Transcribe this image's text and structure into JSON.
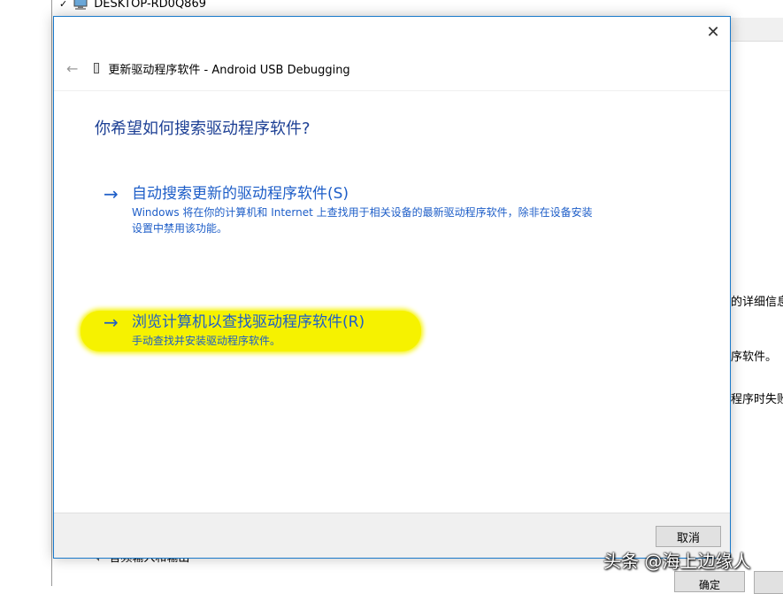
{
  "background": {
    "tree_top_label": "DESKTOP-RD0Q869",
    "tree_bottom_label": "音频输入和输出",
    "right_texts": [
      "的详细信息",
      "序软件。",
      "程序时失败"
    ],
    "ok_button": "确定"
  },
  "dialog": {
    "title": "更新驱动程序软件 - Android USB Debugging",
    "heading": "你希望如何搜索驱动程序软件?",
    "options": [
      {
        "title": "自动搜索更新的驱动程序软件(S)",
        "description": "Windows 将在你的计算机和 Internet 上查找用于相关设备的最新驱动程序软件，除非在设备安装设置中禁用该功能。"
      },
      {
        "title": "浏览计算机以查找驱动程序软件(R)",
        "description": "手动查找并安装驱动程序软件。"
      }
    ],
    "cancel_label": "取消",
    "close_glyph": "✕",
    "back_glyph": "←",
    "arrow_glyph": "→"
  },
  "watermark": "头条 @海上边缘人",
  "icons": {
    "computer": "computer-icon",
    "device": "usb-device-icon",
    "back": "back-arrow-icon",
    "close": "close-icon",
    "option_arrow": "arrow-right-icon"
  },
  "colors": {
    "link_blue": "#1e5ec8",
    "heading_blue": "#1c3f94",
    "highlight": "#f6f200",
    "dialog_border": "#1979ca"
  }
}
